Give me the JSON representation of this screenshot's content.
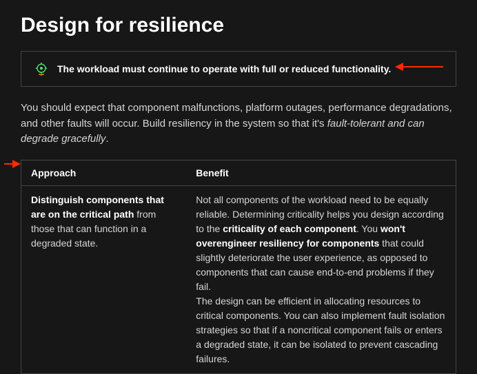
{
  "title": "Design for resilience",
  "callout": {
    "icon_name": "target-scope",
    "message": "The workload must continue to operate with full or reduced functionality."
  },
  "intro": {
    "pre": "You should expect that component malfunctions, platform outages, performance degradations, and other faults will occur. Build resiliency in the system so that it's ",
    "em": "fault-tolerant and can degrade gracefully",
    "post": "."
  },
  "table": {
    "headers": {
      "approach": "Approach",
      "benefit": "Benefit"
    },
    "row": {
      "approach_bold": "Distinguish components that are on the critical path",
      "approach_rest": " from those that can function in a degraded state.",
      "benefit_a": "Not all components of the workload need to be equally reliable. Determining criticality helps you design according to the ",
      "benefit_b_bold": "criticality of each component",
      "benefit_c": ". You ",
      "benefit_d_bold": "won't overengineer resiliency for components",
      "benefit_e": " that could slightly deteriorate the user experience, as opposed to components that can cause end-to-end problems if they fail.",
      "benefit_f": "The design can be efficient in allocating resources to critical components. You can also implement fault isolation strategies so that if a noncritical component fails or enters a degraded state, it can be isolated to prevent cascading failures."
    }
  },
  "annotations": {
    "arrow1": "pointer-to-callout",
    "arrow2": "pointer-to-table"
  }
}
